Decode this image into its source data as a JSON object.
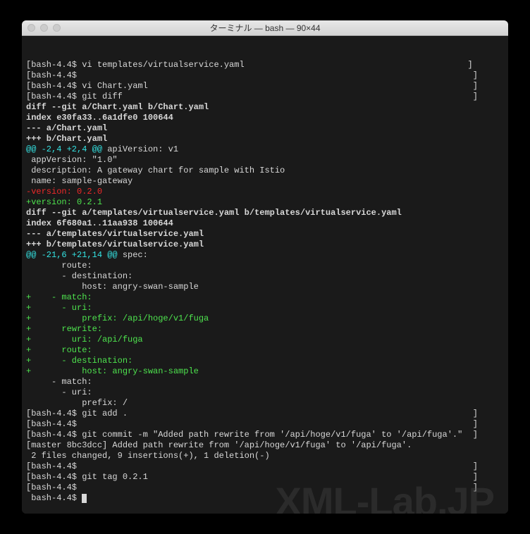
{
  "window": {
    "title": "ターミナル — bash — 90×44"
  },
  "lines": [
    {
      "text": "[bash-4.4$ vi templates/virtualservice.yaml                                            ]",
      "cls": "prompt"
    },
    {
      "text": "[bash-4.4$                                                                              ]",
      "cls": "prompt"
    },
    {
      "text": "[bash-4.4$ vi Chart.yaml                                                                ]",
      "cls": "prompt"
    },
    {
      "text": "[bash-4.4$ git diff                                                                     ]",
      "cls": "prompt"
    },
    {
      "text": "diff --git a/Chart.yaml b/Chart.yaml",
      "cls": "bold"
    },
    {
      "text": "index e30fa33..6a1dfe0 100644",
      "cls": "bold"
    },
    {
      "text": "--- a/Chart.yaml",
      "cls": "bold"
    },
    {
      "text": "+++ b/Chart.yaml",
      "cls": "bold"
    },
    {
      "segments": [
        {
          "text": "@@ -2,4 +2,4 @@",
          "cls": "cyan"
        },
        {
          "text": " apiVersion: v1",
          "cls": ""
        }
      ]
    },
    {
      "text": " appVersion: \"1.0\"",
      "cls": ""
    },
    {
      "text": " description: A gateway chart for sample with Istio",
      "cls": ""
    },
    {
      "text": " name: sample-gateway",
      "cls": ""
    },
    {
      "text": "-version: 0.2.0",
      "cls": "red"
    },
    {
      "text": "+version: 0.2.1",
      "cls": "green"
    },
    {
      "text": "diff --git a/templates/virtualservice.yaml b/templates/virtualservice.yaml",
      "cls": "bold"
    },
    {
      "text": "index 6f680a1..11aa938 100644",
      "cls": "bold"
    },
    {
      "text": "--- a/templates/virtualservice.yaml",
      "cls": "bold"
    },
    {
      "text": "+++ b/templates/virtualservice.yaml",
      "cls": "bold"
    },
    {
      "segments": [
        {
          "text": "@@ -21,6 +21,14 @@",
          "cls": "cyan"
        },
        {
          "text": " spec:",
          "cls": ""
        }
      ]
    },
    {
      "text": "       route:",
      "cls": ""
    },
    {
      "text": "       - destination:",
      "cls": ""
    },
    {
      "text": "           host: angry-swan-sample",
      "cls": ""
    },
    {
      "text": "+    - match:",
      "cls": "green"
    },
    {
      "text": "+      - uri:",
      "cls": "green"
    },
    {
      "text": "+          prefix: /api/hoge/v1/fuga",
      "cls": "green"
    },
    {
      "text": "+      rewrite:",
      "cls": "green"
    },
    {
      "text": "+        uri: /api/fuga",
      "cls": "green"
    },
    {
      "text": "+      route:",
      "cls": "green"
    },
    {
      "text": "+      - destination:",
      "cls": "green"
    },
    {
      "text": "+          host: angry-swan-sample",
      "cls": "green"
    },
    {
      "text": "     - match:",
      "cls": ""
    },
    {
      "text": "       - uri:",
      "cls": ""
    },
    {
      "text": "           prefix: /",
      "cls": ""
    },
    {
      "text": "[bash-4.4$ git add .                                                                    ]",
      "cls": "prompt"
    },
    {
      "text": "[bash-4.4$                                                                              ]",
      "cls": "prompt"
    },
    {
      "text": "[bash-4.4$ git commit -m \"Added path rewrite from '/api/hoge/v1/fuga' to '/api/fuga'.\"  ]",
      "cls": "prompt"
    },
    {
      "text": "[master 8bc3dcc] Added path rewrite from '/api/hoge/v1/fuga' to '/api/fuga'.",
      "cls": ""
    },
    {
      "text": " 2 files changed, 9 insertions(+), 1 deletion(-)",
      "cls": ""
    },
    {
      "text": "[bash-4.4$                                                                              ]",
      "cls": "prompt"
    },
    {
      "text": "[bash-4.4$ git tag 0.2.1                                                                ]",
      "cls": "prompt"
    },
    {
      "text": "[bash-4.4$                                                                              ]",
      "cls": "prompt"
    }
  ],
  "cursor_prompt": " bash-4.4$ ",
  "watermark": "XML-Lab.JP"
}
